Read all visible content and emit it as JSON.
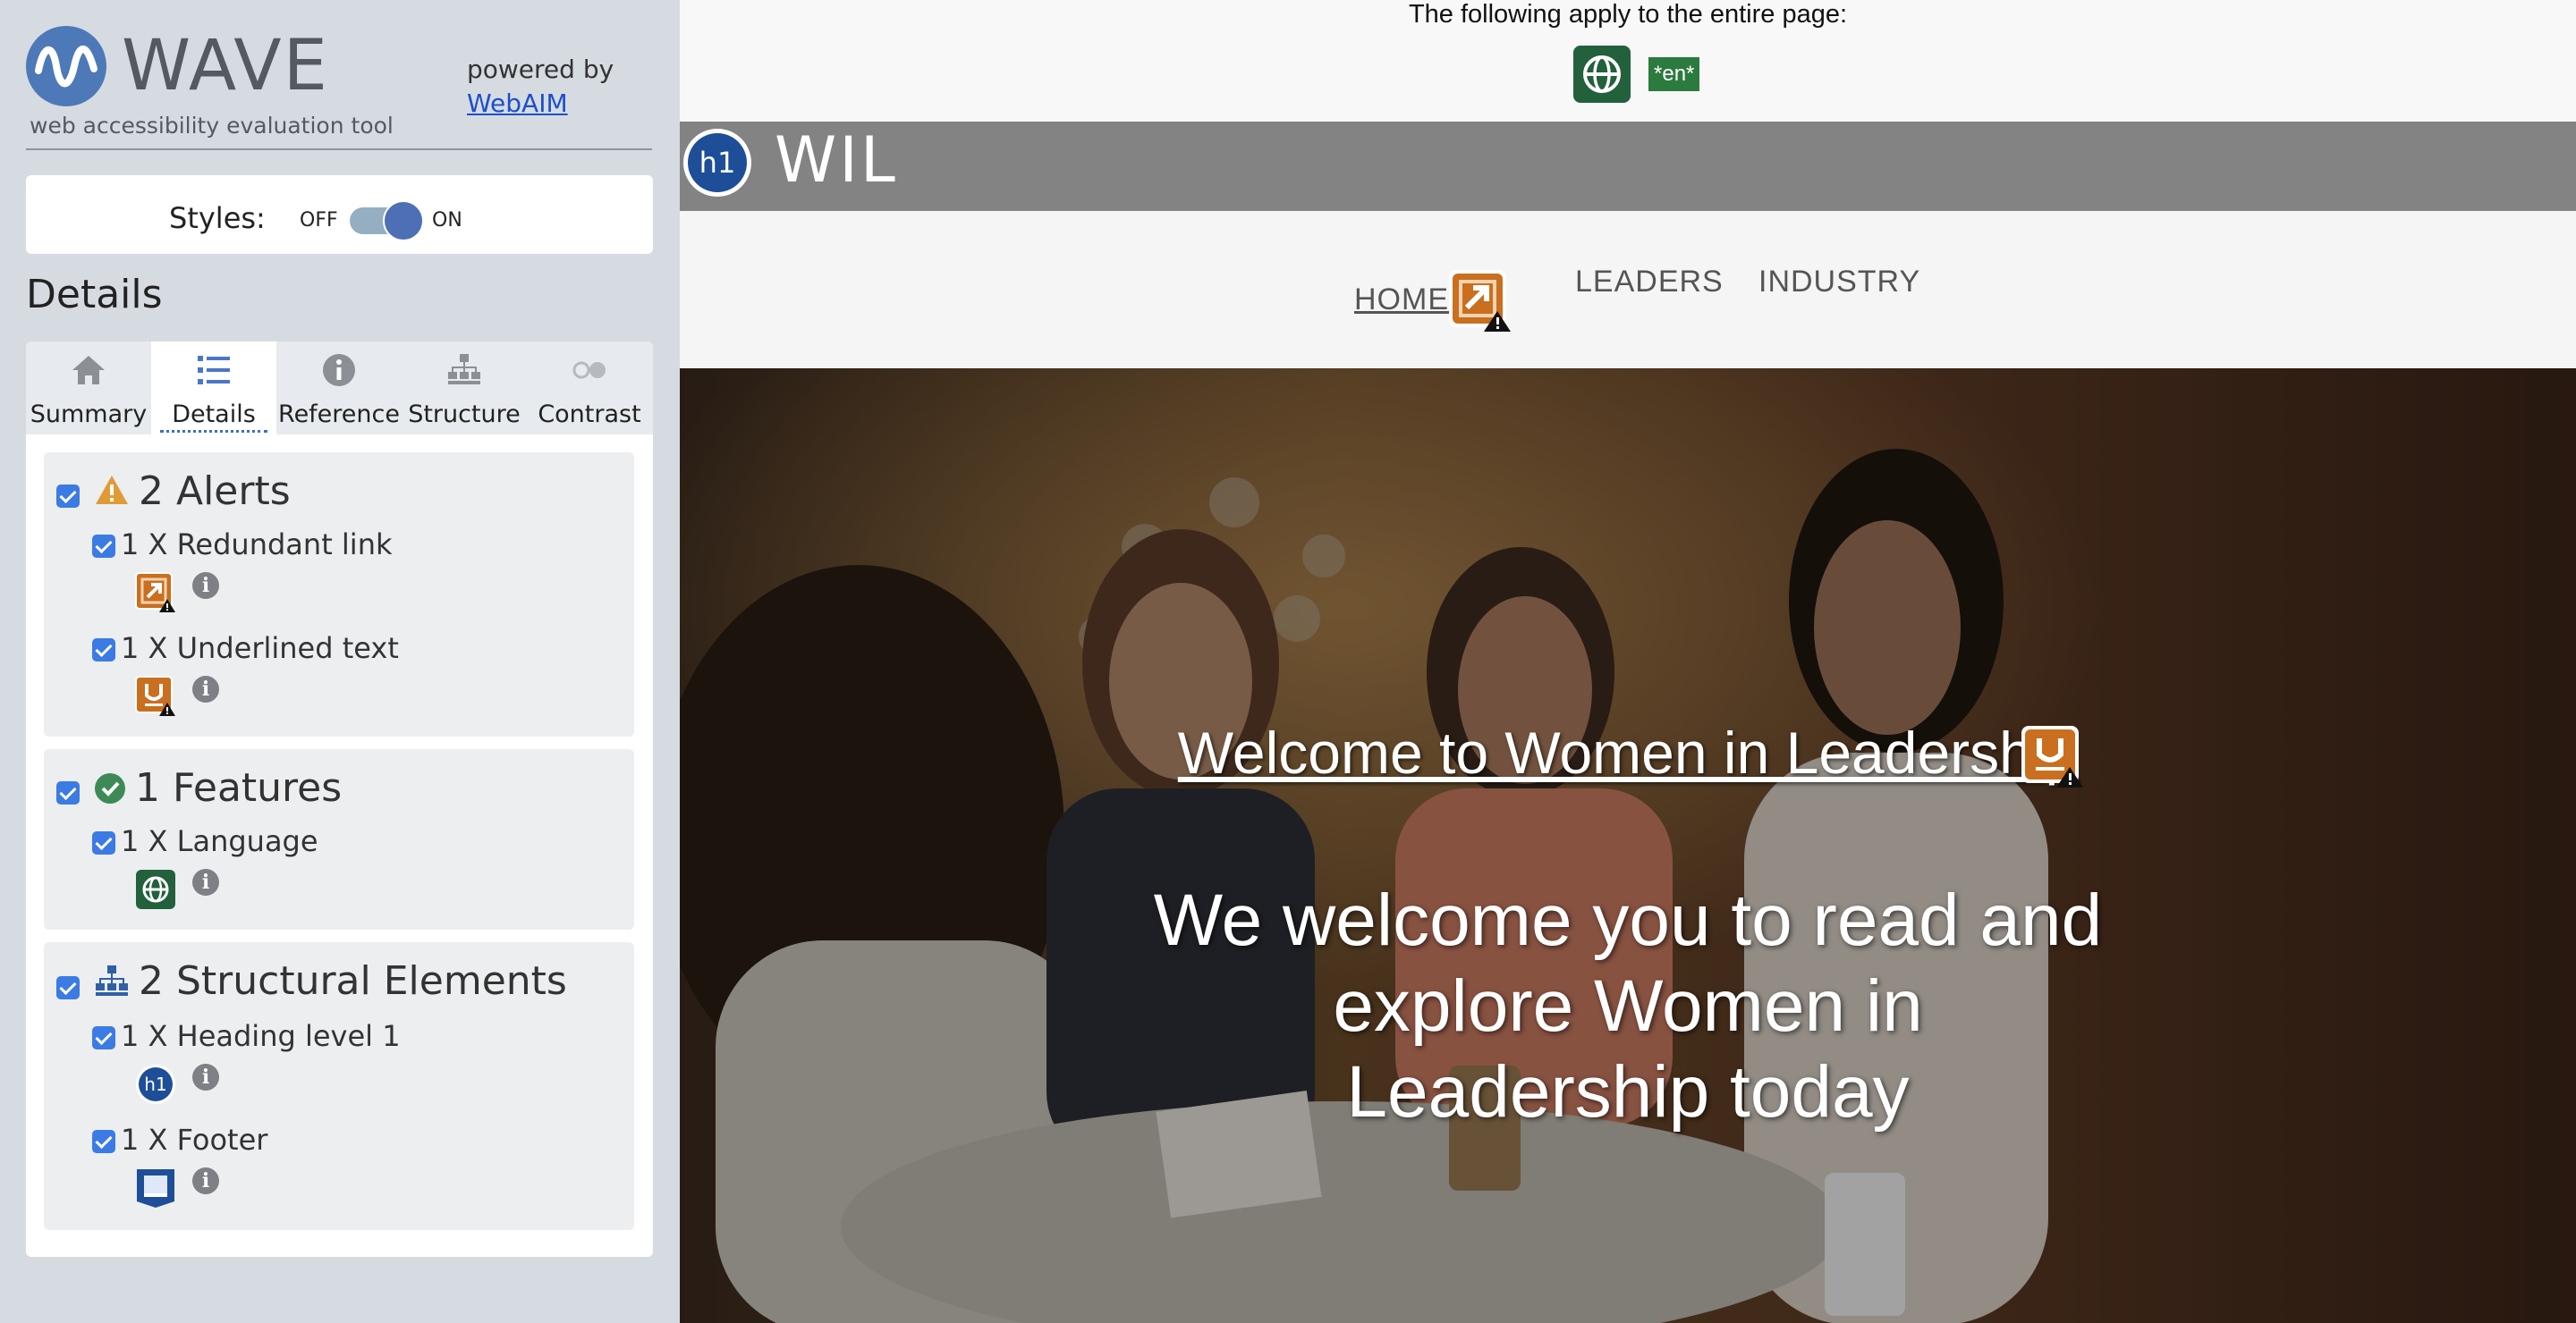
{
  "sidebar": {
    "logo": {
      "name": "WAVE",
      "subtitle": "web accessibility evaluation tool"
    },
    "powered_by": {
      "text": "powered by",
      "link": "WebAIM"
    },
    "styles": {
      "label": "Styles:",
      "off": "OFF",
      "on": "ON",
      "state": "on"
    },
    "details_heading": "Details",
    "tabs": [
      {
        "label": "Summary",
        "icon": "home-icon"
      },
      {
        "label": "Details",
        "icon": "list-icon",
        "active": true
      },
      {
        "label": "Reference",
        "icon": "info-icon"
      },
      {
        "label": "Structure",
        "icon": "hierarchy-icon"
      },
      {
        "label": "Contrast",
        "icon": "contrast-icon"
      }
    ],
    "groups": {
      "alerts": {
        "title": "2 Alerts",
        "items": [
          {
            "label": "1 X Redundant link",
            "icon": "redundant-link-icon"
          },
          {
            "label": "1 X Underlined text",
            "icon": "underline-icon"
          }
        ]
      },
      "features": {
        "title": "1 Features",
        "items": [
          {
            "label": "1 X Language",
            "icon": "language-globe-icon"
          }
        ]
      },
      "structure": {
        "title": "2 Structural Elements",
        "items": [
          {
            "label": "1 X Heading level 1",
            "icon": "h1-icon"
          },
          {
            "label": "1 X Footer",
            "icon": "footer-icon"
          }
        ]
      }
    }
  },
  "main": {
    "apply_text": "The following apply to the entire page:",
    "lang_tag": "*en*",
    "site_title": "WIL",
    "h1_badge": "h1",
    "nav": {
      "home": "HOME",
      "leaders": "LEADERS",
      "industry": "INDUSTRY"
    },
    "hero": {
      "heading": "Welcome to Women in Leadership",
      "text": "We welcome you to read and explore Women in Leadership today"
    }
  },
  "colors": {
    "sidebar_bg": "#d6dbe1",
    "alert_orange": "#c96f1f",
    "feature_green": "#23603c",
    "structure_blue": "#1e4e98",
    "checkbox_blue": "#3b7be3"
  }
}
